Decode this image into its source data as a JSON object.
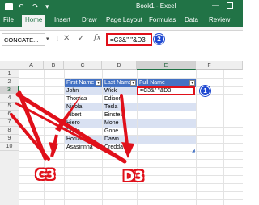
{
  "titlebar": {
    "undo": "↶",
    "redo": "↷",
    "more": "▾",
    "title": "Book1 - Excel",
    "minimize": "—",
    "accent": "#217346"
  },
  "ribbon_tabs": [
    {
      "label": "File"
    },
    {
      "label": "Home"
    },
    {
      "label": "Insert"
    },
    {
      "label": "Draw"
    },
    {
      "label": "Page Layout"
    },
    {
      "label": "Formulas"
    },
    {
      "label": "Data"
    },
    {
      "label": "Review"
    }
  ],
  "formula_bar": {
    "name_box": "CONCATE...",
    "cancel": "✕",
    "enter": "✓",
    "fx": "fx",
    "formula": "=C3&\" \"&D3"
  },
  "columns": [
    "A",
    "B",
    "C",
    "D",
    "E",
    "F"
  ],
  "rows": [
    "1",
    "2",
    "3",
    "4",
    "5",
    "6",
    "7",
    "8",
    "9",
    "10"
  ],
  "table": {
    "headers": [
      "First Name",
      "Last Name",
      "Full Name"
    ],
    "rows": [
      [
        "John",
        "Wick"
      ],
      [
        "Thomas",
        "Edison"
      ],
      [
        "Nicola",
        "Tesla"
      ],
      [
        "Albert",
        "Einstein"
      ],
      [
        "Hiero",
        "Mone"
      ],
      [
        "Dodo",
        "Gone"
      ],
      [
        "Horizon",
        "Dawn"
      ],
      [
        "Asasinnna",
        "Credda"
      ]
    ],
    "editing_value": "=C3&\" \"&D3"
  },
  "annotations": {
    "marker_1": "1",
    "marker_2": "2",
    "label_c3": "C3",
    "label_d3": "D3",
    "color": "#e0101a",
    "marker_color": "#1f49d1"
  }
}
